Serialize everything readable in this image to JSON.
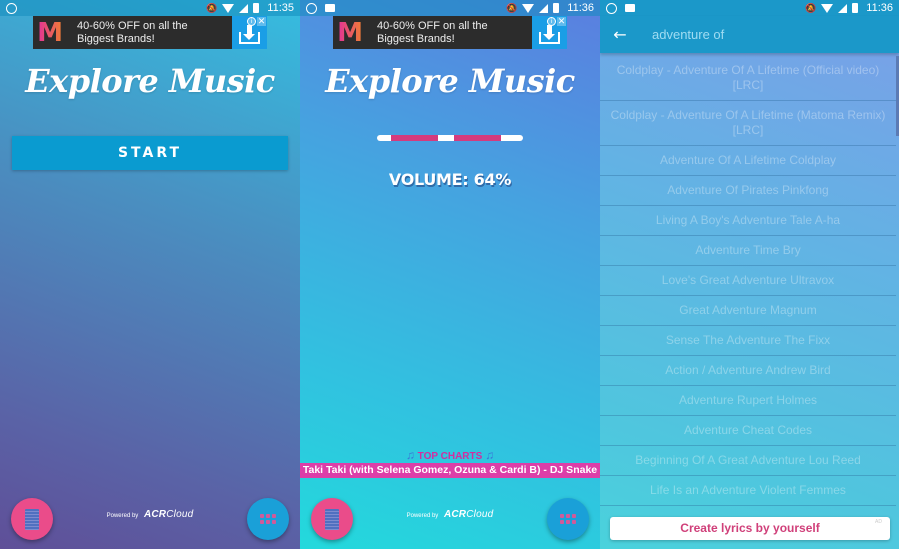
{
  "screens": [
    {
      "status": {
        "time": "11:35"
      },
      "ad": {
        "text_line1": "40-60% OFF on all the",
        "text_line2": "Biggest Brands!",
        "logo": "M",
        "info_icon": "i",
        "close_icon": "✕"
      },
      "title": "Explore Music",
      "start_label": "START",
      "powered_by": "Powered by",
      "brand_acr": "ACR",
      "brand_cloud": "Cloud"
    },
    {
      "status": {
        "time": "11:36"
      },
      "ad": {
        "text_line1": "40-60% OFF on all the",
        "text_line2": "Biggest Brands!",
        "logo": "M",
        "info_icon": "i",
        "close_icon": "✕"
      },
      "title": "Explore Music",
      "volume": {
        "percent": 64,
        "label": "VOLUME: 64%"
      },
      "top_charts": {
        "label": "TOP CHARTS",
        "note_icon": "♫",
        "song": "Taki Taki (with Selena Gomez, Ozuna & Cardi B) - DJ Snake"
      },
      "powered_by": "Powered by",
      "brand_acr": "ACR",
      "brand_cloud": "Cloud"
    },
    {
      "status": {
        "time": "11:36"
      },
      "search": {
        "query": "adventure of",
        "back_icon": "←"
      },
      "results": [
        "Coldplay - Adventure Of A Lifetime (Official video) [LRC]",
        "Coldplay - Adventure Of A Lifetime (Matoma Remix) [LRC]",
        "Adventure Of A Lifetime Coldplay",
        "Adventure Of Pirates Pinkfong",
        "Living A Boy's Adventure Tale A-ha",
        "Adventure Time Bry",
        "Love's Great Adventure Ultravox",
        "Great Adventure Magnum",
        "Sense The Adventure The Fixx",
        "Action / Adventure Andrew Bird",
        "Adventure Rupert Holmes",
        "Adventure Cheat Codes",
        "Beginning Of A Great Adventure Lou Reed",
        "Life Is an Adventure Violent Femmes"
      ],
      "lyrics_ad": {
        "label": "Create lyrics by yourself",
        "ad_tag": "AD"
      }
    }
  ],
  "colors": {
    "accent_pink": "#dd3ea8",
    "start_button": "#0a9bd0",
    "appbar": "#1b98c9",
    "volume_fill": "#d43b7d"
  }
}
